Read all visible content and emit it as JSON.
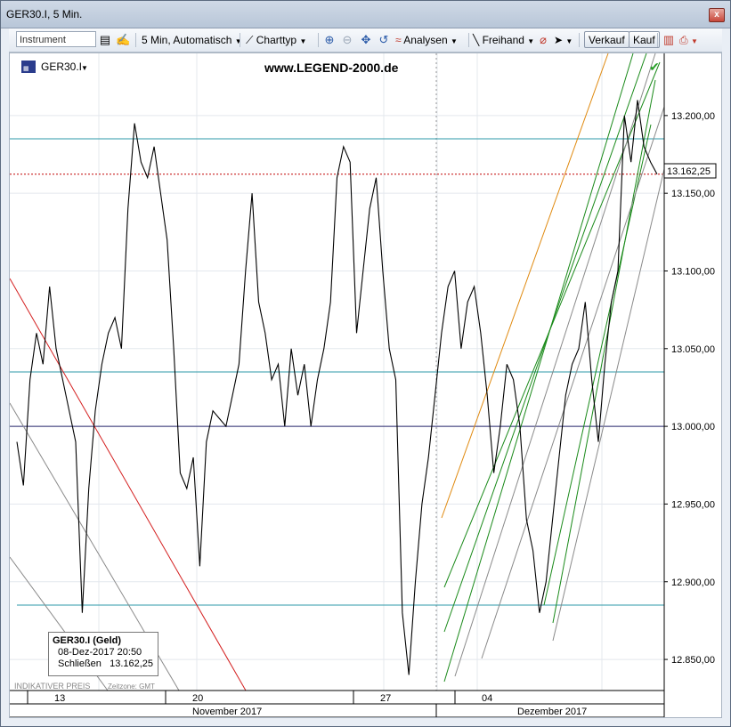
{
  "window": {
    "title": "GER30.I, 5 Min.",
    "close_label": "x"
  },
  "toolbar": {
    "instrument_placeholder": "Instrument",
    "interval_label": "5 Min,",
    "mode_label": "Automatisch",
    "charttype_label": "Charttyp",
    "analysen_label": "Analysen",
    "freihand_label": "Freihand",
    "sell_label": "Verkauf",
    "buy_label": "Kauf"
  },
  "chart": {
    "symbol": "GER30.I",
    "watermark": "www.LEGEND-2000.de",
    "indicative": "INDIKATIVER PREIS",
    "timezone": "Zeitzone: GMT",
    "current_price": "13.162,25",
    "y_ticks": [
      "13.200,00",
      "13.150,00",
      "13.100,00",
      "13.050,00",
      "13.000,00",
      "12.950,00",
      "12.900,00",
      "12.850,00"
    ],
    "x_day_labels": [
      "13",
      "20",
      "27",
      "04"
    ],
    "x_month_labels": [
      "November 2017",
      "Dezember 2017"
    ]
  },
  "tooltip": {
    "title": "GER30.I (Geld)",
    "datetime": "08-Dez-2017 20:50",
    "close_label": "Schließen",
    "close_value": "13.162,25"
  },
  "colors": {
    "price_line": "#000000",
    "horizontal_cyan": "#2e9aa8",
    "horizontal_navy": "#28286e",
    "current_price_line": "#c00000",
    "trend_red": "#d42020",
    "trend_green": "#1a8a1a",
    "trend_orange": "#e08a10",
    "trend_gray": "#8a8a8a"
  },
  "chart_data": {
    "type": "line",
    "series": [
      {
        "values": [
          12990,
          12962,
          13030,
          13060,
          13040,
          13090,
          13050,
          13030,
          13010,
          12990,
          12880,
          12960,
          13010,
          13040,
          13060,
          13070,
          13050,
          13140,
          13195,
          13170,
          13160,
          13180,
          13150,
          13120,
          13050,
          12970,
          12960,
          12980,
          12910,
          12990,
          13010,
          13005,
          13000,
          13020,
          13040,
          13100,
          13150,
          13080,
          13060,
          13030,
          13040,
          13000,
          13050,
          13020,
          13040,
          13000,
          13030,
          13050,
          13080,
          13160,
          13180,
          13170,
          13060,
          13100,
          13140,
          13160,
          13100,
          13050,
          13030,
          12880,
          12840,
          12900,
          12950,
          12980,
          13020,
          13060,
          13090,
          13100,
          13050,
          13080,
          13090,
          13060,
          13020,
          12970,
          13000,
          13040,
          13030,
          13000,
          12940,
          12920,
          12880,
          12900,
          12940,
          12980,
          13020,
          13040,
          13050,
          13080,
          13030,
          12990,
          13040,
          13080,
          13100,
          13200,
          13170,
          13210,
          13180,
          13170,
          13162.25
        ]
      }
    ],
    "ylim": [
      12830,
      13240
    ],
    "horizontal_levels": [
      13185,
      13162.25,
      13035,
      13000,
      12885
    ],
    "grid": true
  }
}
